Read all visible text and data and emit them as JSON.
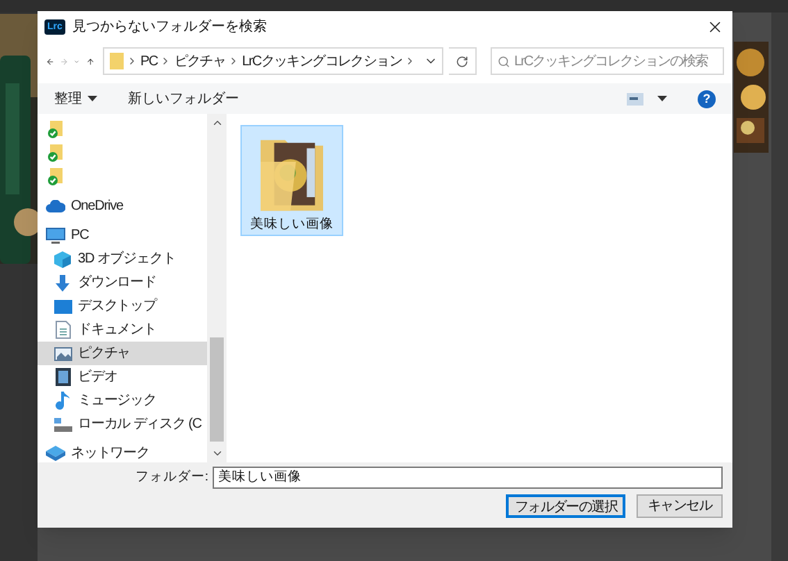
{
  "window": {
    "app_badge": "Lrc",
    "title": "見つからないフォルダーを検索"
  },
  "navigation": {
    "forward_disabled": true,
    "breadcrumb": [
      "PC",
      "ピクチャ",
      "LrCクッキングコレクション"
    ],
    "search_placeholder": "LrCクッキングコレクションの検索"
  },
  "toolbar": {
    "organize": "整理",
    "new_folder": "新しいフォルダー",
    "help": "?"
  },
  "nav_pane": [
    {
      "kind": "synced",
      "selected": false
    },
    {
      "kind": "synced",
      "selected": false
    },
    {
      "kind": "synced",
      "selected": false
    },
    {
      "kind": "cloud",
      "label": "OneDrive",
      "selected": false
    },
    {
      "kind": "pc",
      "label": "PC",
      "selected": false,
      "children": [
        {
          "kind": "objects",
          "label": "3D オブジェクト",
          "selected": false
        },
        {
          "kind": "download",
          "label": "ダウンロード",
          "selected": false
        },
        {
          "kind": "desktop",
          "label": "デスクトップ",
          "selected": false
        },
        {
          "kind": "documents",
          "label": "ドキュメント",
          "selected": false
        },
        {
          "kind": "pictures",
          "label": "ピクチャ",
          "selected": true
        },
        {
          "kind": "videos",
          "label": "ビデオ",
          "selected": false
        },
        {
          "kind": "music",
          "label": "ミュージック",
          "selected": false
        },
        {
          "kind": "disk",
          "label": "ローカル ディスク (C",
          "selected": false
        }
      ]
    },
    {
      "kind": "network",
      "label": "ネットワーク",
      "selected": false
    }
  ],
  "files": [
    {
      "name": "美味しい画像",
      "selected": true
    }
  ],
  "folder_field": {
    "label": "フォルダー:",
    "value": "美味しい画像"
  },
  "buttons": [
    {
      "label": "フォルダーの選択",
      "primary": true
    },
    {
      "label": "キャンセル",
      "primary": false
    }
  ]
}
